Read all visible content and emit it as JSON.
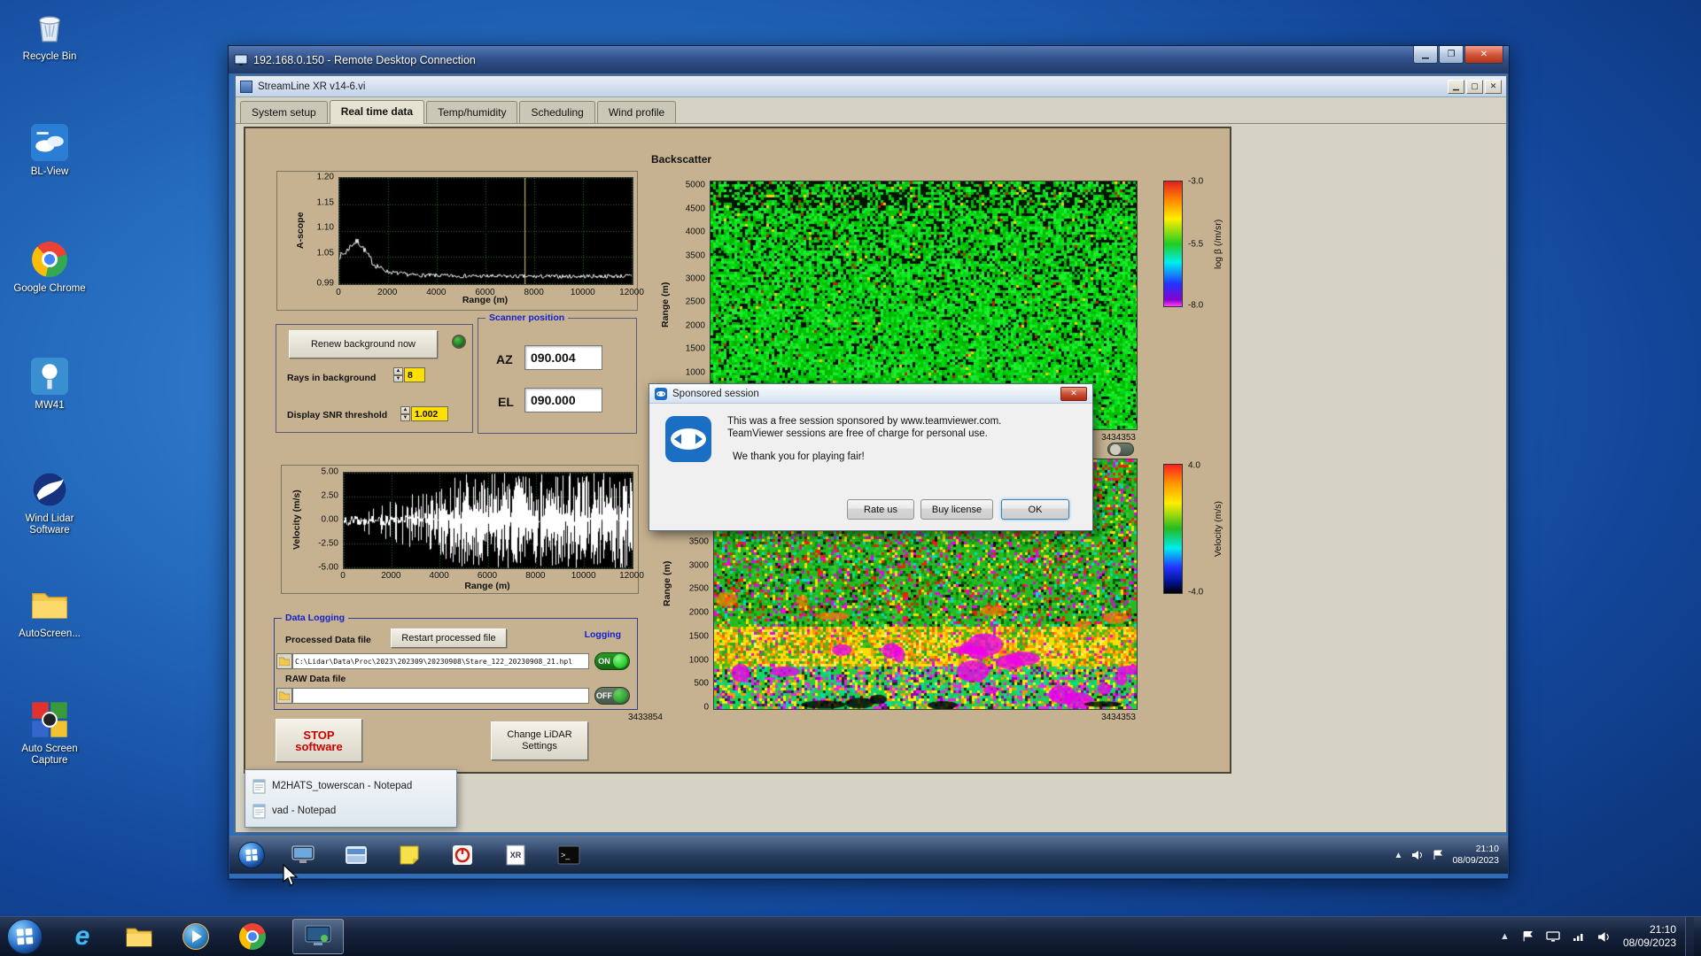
{
  "desktop": {
    "icons": [
      {
        "label": "Recycle Bin",
        "icon": "recycle-bin-icon"
      },
      {
        "label": "BL-View",
        "icon": "bl-view-icon"
      },
      {
        "label": "Google Chrome",
        "icon": "chrome-icon"
      },
      {
        "label": "MW41",
        "icon": "mw41-icon"
      },
      {
        "label": "Wind Lidar Software",
        "icon": "wind-lidar-icon"
      },
      {
        "label": "AutoScreen...",
        "icon": "folder-icon"
      },
      {
        "label": "Auto Screen Capture",
        "icon": "auto-screen-capture-icon"
      }
    ]
  },
  "rdp_window": {
    "title": "192.168.0.150 - Remote Desktop Connection"
  },
  "app_window": {
    "title": "StreamLine XR v14-6.vi",
    "tabs": [
      "System setup",
      "Real time data",
      "Temp/humidity",
      "Scheduling",
      "Wind profile"
    ],
    "active_tab": "Real time data",
    "controls": {
      "renew_button": "Renew background now",
      "rays_label": "Rays in background",
      "rays_value": "8",
      "snr_label": "Display SNR threshold",
      "snr_value": "1.002",
      "scanner_box_title": "Scanner position",
      "az_label": "AZ",
      "az_value": "090.004",
      "el_label": "EL",
      "el_value": "090.000"
    },
    "data_logging": {
      "box_title": "Data Logging",
      "processed_label": "Processed Data file",
      "restart_button": "Restart processed file",
      "logging_label": "Logging",
      "processed_path": "C:\\Lidar\\Data\\Proc\\2023\\202309\\20230908\\Stare_122_20230908_21.hpl",
      "processed_state": "ON",
      "raw_label": "RAW Data file",
      "raw_path": "",
      "raw_state": "OFF"
    },
    "stop_button": "STOP software",
    "change_settings_button": "Change LiDAR Settings"
  },
  "dialog": {
    "title": "Sponsored session",
    "line1": "This was a free session sponsored by www.teamviewer.com.",
    "line2": "TeamViewer sessions are free of charge for personal use.",
    "line3": "We thank you for playing fair!",
    "buttons": {
      "rate": "Rate us",
      "buy": "Buy license",
      "ok": "OK"
    }
  },
  "remote_taskbar": {
    "popup": [
      "M2HATS_towerscan - Notepad",
      "vad - Notepad"
    ],
    "time": "21:10",
    "date": "08/09/2023",
    "icons": [
      "computer-icon",
      "explorer-icon",
      "notes-icon",
      "power-icon",
      "streamline-icon",
      "console-icon"
    ]
  },
  "host_taskbar": {
    "time": "21:10",
    "date": "08/09/2023",
    "icons": [
      "start",
      "internet-explorer",
      "windows-explorer",
      "media-player",
      "chrome",
      "remote-desktop"
    ]
  },
  "chart_data": [
    {
      "id": "ascope",
      "type": "line",
      "ylabel": "A-scope",
      "xlabel": "Range (m)",
      "xlim": [
        0,
        12000
      ],
      "ylim": [
        0.99,
        1.2
      ],
      "yticks": [
        "1.20",
        "1.15",
        "1.10",
        "1.05",
        "0.99"
      ],
      "xticks": [
        "0",
        "2000",
        "4000",
        "6000",
        "8000",
        "10000",
        "12000"
      ],
      "bg": "#000000",
      "grid_color": "#2a6b2a",
      "line_color": "#ffffff",
      "cursor_x": 7600,
      "profile": [
        [
          0,
          1.045
        ],
        [
          250,
          1.052
        ],
        [
          500,
          1.068
        ],
        [
          750,
          1.075
        ],
        [
          1000,
          1.06
        ],
        [
          1400,
          1.03
        ],
        [
          2000,
          1.014
        ],
        [
          3000,
          1.008
        ],
        [
          5000,
          1.006
        ],
        [
          8000,
          1.005
        ],
        [
          12000,
          1.006
        ]
      ],
      "noise": 0.004,
      "description": "A-scope backscatter trace: peak near 700 m decaying to a flat noisy baseline around 1.005"
    },
    {
      "id": "velocity_trace",
      "type": "line",
      "ylabel": "Velocity (m/s)",
      "xlabel": "Range (m)",
      "xlim": [
        0,
        12000
      ],
      "ylim": [
        -5,
        5
      ],
      "yticks": [
        "5.00",
        "2.50",
        "0.00",
        "-2.50",
        "-5.00"
      ],
      "xticks": [
        "0",
        "2000",
        "4000",
        "6000",
        "8000",
        "10000",
        "12000"
      ],
      "bg": "#000000",
      "grid_color": "#2a6b2a",
      "line_color": "#ffffff",
      "description": "Radial velocity vs range: small fluctuations near 0 at short range, noise spikes saturating to ±5 m/s beyond ~2000 m"
    },
    {
      "id": "backscatter_heatmap",
      "type": "heatmap",
      "title": "Backscatter",
      "ylabel": "Range (m)",
      "yticks": [
        "5000",
        "4500",
        "4000",
        "3500",
        "3000",
        "2500",
        "2000",
        "1500",
        "1000"
      ],
      "x_end_label": "3434353",
      "colorbar": {
        "label": "log β (/m/sr)",
        "ticks": [
          "-3.0",
          "-5.5",
          "-8.0"
        ],
        "stops": [
          [
            0,
            "#e02020"
          ],
          [
            0.15,
            "#ff8800"
          ],
          [
            0.3,
            "#ffee00"
          ],
          [
            0.5,
            "#22cc22"
          ],
          [
            0.65,
            "#00eeee"
          ],
          [
            0.82,
            "#2233ff"
          ],
          [
            0.95,
            "#8800cc"
          ],
          [
            1,
            "#ff44ff"
          ]
        ]
      },
      "description": "Time-height backscatter: near-uniform green noise with dark speckle, denser dark speckle near top of range"
    },
    {
      "id": "velocity_heatmap",
      "type": "heatmap",
      "ylabel": "Range (m)",
      "yticks": [
        "3500",
        "3000",
        "2500",
        "2000",
        "1500",
        "1000",
        "500",
        "0"
      ],
      "xticks": [
        "3433854",
        "3434353"
      ],
      "colorbar": {
        "label": "Velocity (m/s)",
        "ticks": [
          "4.0",
          "-4.0"
        ],
        "stops": [
          [
            0,
            "#ff2020"
          ],
          [
            0.15,
            "#ff9900"
          ],
          [
            0.3,
            "#ffee00"
          ],
          [
            0.5,
            "#22bb22"
          ],
          [
            0.65,
            "#00eeee"
          ],
          [
            0.8,
            "#2233ff"
          ],
          [
            0.92,
            "#001188"
          ],
          [
            1,
            "#000000"
          ]
        ]
      },
      "description": "Time-height radial velocity: multicoloured noise aloft, coherent yellow/orange and green bands below ~1500 m with magenta patches near the surface"
    }
  ]
}
